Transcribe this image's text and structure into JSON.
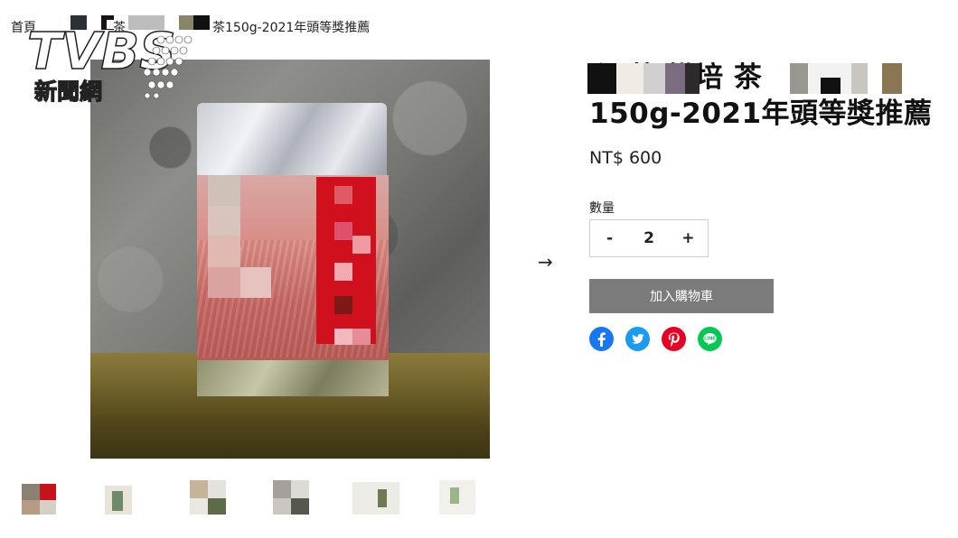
{
  "breadcrumb": {
    "home": "首頁",
    "middle": "茶",
    "product": "茶150g-2021年頭等獎推薦"
  },
  "watermark": {
    "brand": "TVBS",
    "subtitle": "新聞網"
  },
  "product": {
    "title_line1": "私‌ 茶 烘培 茶",
    "title_line2": "150g-2021年頭等獎推薦",
    "price": "NT$ 600",
    "quantity_label": "數量",
    "quantity": "2",
    "decrement": "-",
    "increment": "+",
    "add_to_cart": "加入購物車"
  },
  "navigation": {
    "next_arrow": "→"
  },
  "share": [
    {
      "name": "facebook-icon",
      "color": "#1877f2"
    },
    {
      "name": "twitter-icon",
      "color": "#1d9bf0"
    },
    {
      "name": "pinterest-icon",
      "color": "#e60023"
    },
    {
      "name": "line-icon",
      "color": "#06c755"
    }
  ]
}
